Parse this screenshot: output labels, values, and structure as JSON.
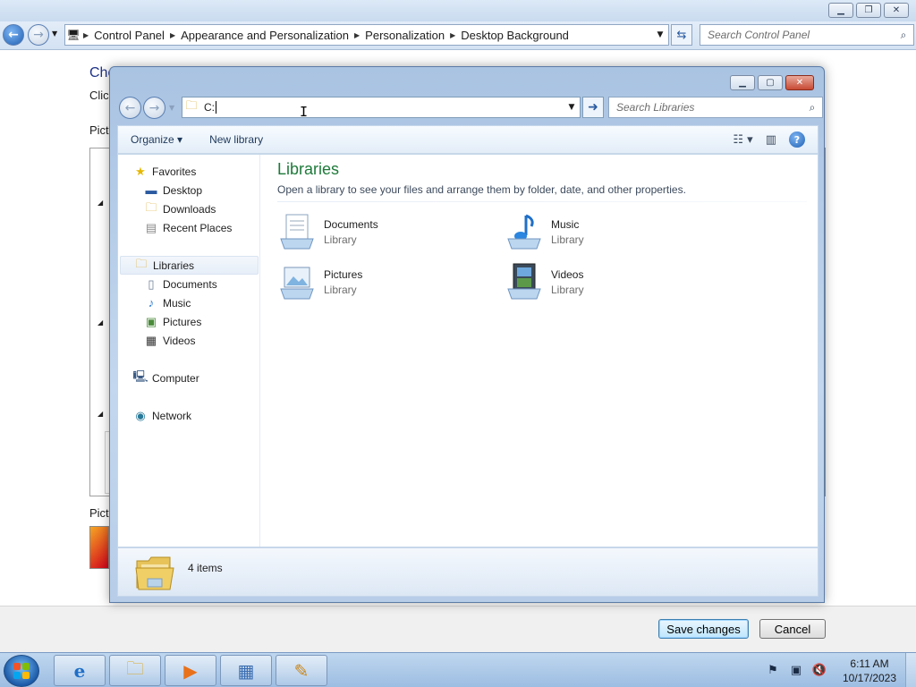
{
  "control_panel": {
    "breadcrumb": [
      "Control Panel",
      "Appearance and Personalization",
      "Personalization",
      "Desktop Background"
    ],
    "search_placeholder": "Search Control Panel",
    "heading_fragment": "Cho",
    "sub_fragment": "Click",
    "picture_location_fragment": "Pictu",
    "picture_position_fragment": "Pictu",
    "save_label": "Save changes",
    "cancel_label": "Cancel"
  },
  "dialog": {
    "address_value": "C:",
    "search_placeholder": "Search Libraries",
    "toolbar": {
      "organize": "Organize ▾",
      "new_library": "New library"
    },
    "nav": {
      "favorites": "Favorites",
      "desktop": "Desktop",
      "downloads": "Downloads",
      "recent": "Recent Places",
      "libraries": "Libraries",
      "documents": "Documents",
      "music": "Music",
      "pictures": "Pictures",
      "videos": "Videos",
      "computer": "Computer",
      "network": "Network"
    },
    "main": {
      "title": "Libraries",
      "subtitle": "Open a library to see your files and arrange them by folder, date, and other properties.",
      "libraries": [
        {
          "name": "Documents",
          "type": "Library",
          "icon": "documents-library-icon"
        },
        {
          "name": "Music",
          "type": "Library",
          "icon": "music-library-icon"
        },
        {
          "name": "Pictures",
          "type": "Library",
          "icon": "pictures-library-icon"
        },
        {
          "name": "Videos",
          "type": "Library",
          "icon": "videos-library-icon"
        }
      ]
    },
    "details": {
      "count": "4 items"
    }
  },
  "taskbar": {
    "clock_time": "6:11 AM",
    "clock_date": "10/17/2023",
    "pinned": [
      "internet-explorer-icon",
      "windows-explorer-icon",
      "media-player-icon",
      "control-panel-icon",
      "paint-icon"
    ]
  }
}
